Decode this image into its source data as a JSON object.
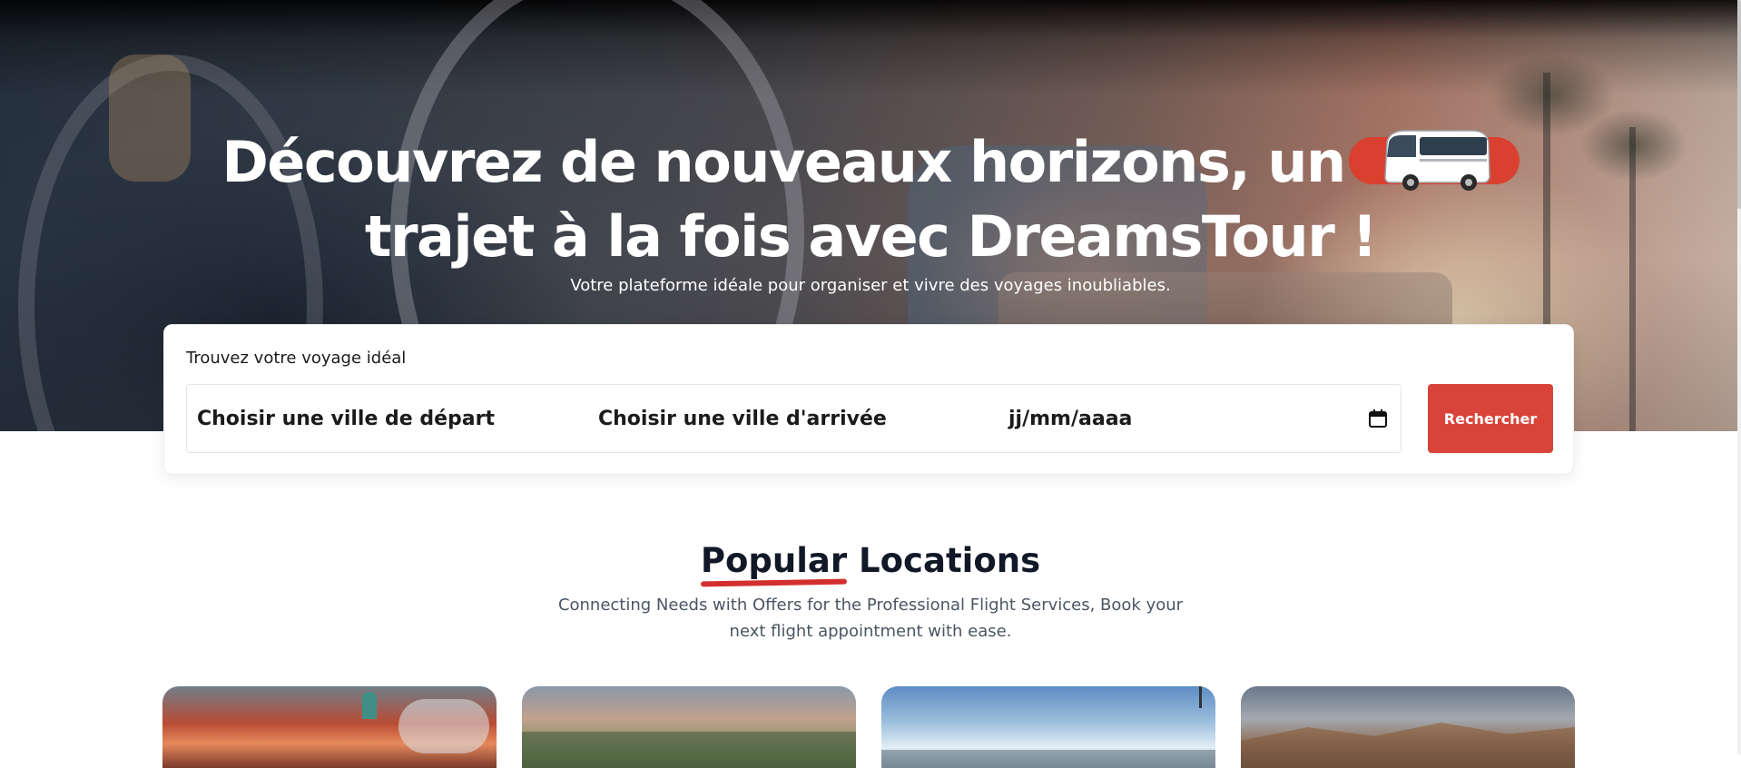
{
  "hero": {
    "title_line1": "Découvrez de nouveaux horizons, un",
    "title_line2": "trajet à la fois avec DreamsTour !",
    "subtitle": "Votre plateforme idéale pour organiser et vivre des voyages inoubliables.",
    "bus_icon": "bus-icon",
    "accent_color": "#d9402f"
  },
  "search": {
    "title": "Trouvez votre voyage idéal",
    "departure_placeholder": "Choisir une ville de départ",
    "arrival_placeholder": "Choisir une ville d'arrivée",
    "date_placeholder": "jj/mm/aaaa",
    "calendar_icon": "calendar-icon",
    "button_label": "Rechercher",
    "button_color": "#d9443a"
  },
  "popular": {
    "title_highlight": "Popular",
    "title_rest": "Locations",
    "description": "Connecting Needs with Offers for the Professional Flight Services, Book your next flight appointment with ease."
  }
}
